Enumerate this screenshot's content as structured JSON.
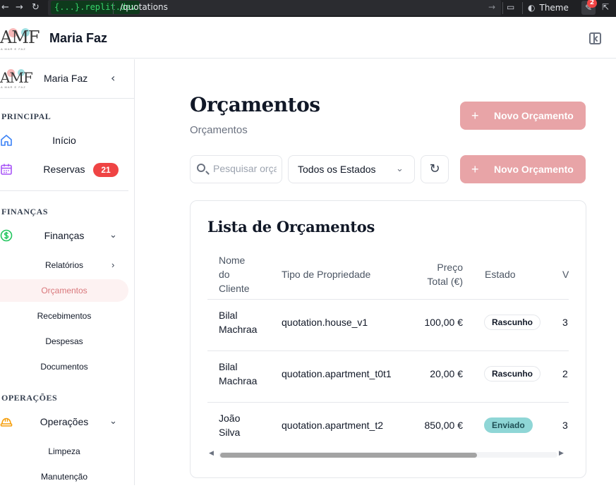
{
  "browser": {
    "host": "{...}.replit.dev",
    "path": "/quotations",
    "theme_label": "Theme",
    "notification_count": "2"
  },
  "app": {
    "logo_text": "AMF",
    "logo_sub": "A MAR E FAZ",
    "title": "Maria Faz"
  },
  "sidebar": {
    "user_name": "Maria Faz",
    "sections": {
      "principal": "PRINCIPAL",
      "financas": "FINANÇAS",
      "operacoes": "OPERAÇÕES"
    },
    "items": {
      "inicio": "Início",
      "reservas": "Reservas",
      "reservas_count": "21",
      "financas": "Finanças",
      "relatorios": "Relatórios",
      "orcamentos": "Orçamentos",
      "recebimentos": "Recebimentos",
      "despesas": "Despesas",
      "documentos": "Documentos",
      "operacoes": "Operações",
      "limpeza": "Limpeza",
      "manutencao": "Manutenção"
    }
  },
  "page": {
    "title": "Orçamentos",
    "subtitle": "Orçamentos",
    "new_button": "Novo Orçamento",
    "search_placeholder": "Pesquisar orçamentos",
    "status_filter": "Todos os Estados",
    "card_title": "Lista de Orçamentos"
  },
  "table": {
    "headers": {
      "client": [
        "Nome",
        "do",
        "Cliente"
      ],
      "property": "Tipo de Propriedade",
      "price": [
        "Preço",
        "Total (€)"
      ],
      "status": "Estado",
      "next": "V"
    },
    "rows": [
      {
        "client": [
          "Bilal",
          "Machraa"
        ],
        "property": "quotation.house_v1",
        "price": "100,00 €",
        "status": "Rascunho",
        "status_type": "draft",
        "next": "3"
      },
      {
        "client": [
          "Bilal",
          "Machraa"
        ],
        "property": "quotation.apartment_t0t1",
        "price": "20,00 €",
        "status": "Rascunho",
        "status_type": "draft",
        "next": "2"
      },
      {
        "client": [
          "João",
          "Silva"
        ],
        "property": "quotation.apartment_t2",
        "price": "850,00 €",
        "status": "Enviado",
        "status_type": "sent",
        "next": "3"
      }
    ]
  },
  "colors": {
    "primary": "#e8a4a7",
    "active_text": "#d9777b",
    "badge": "#ef4444",
    "sent": "#8fd6d6"
  }
}
